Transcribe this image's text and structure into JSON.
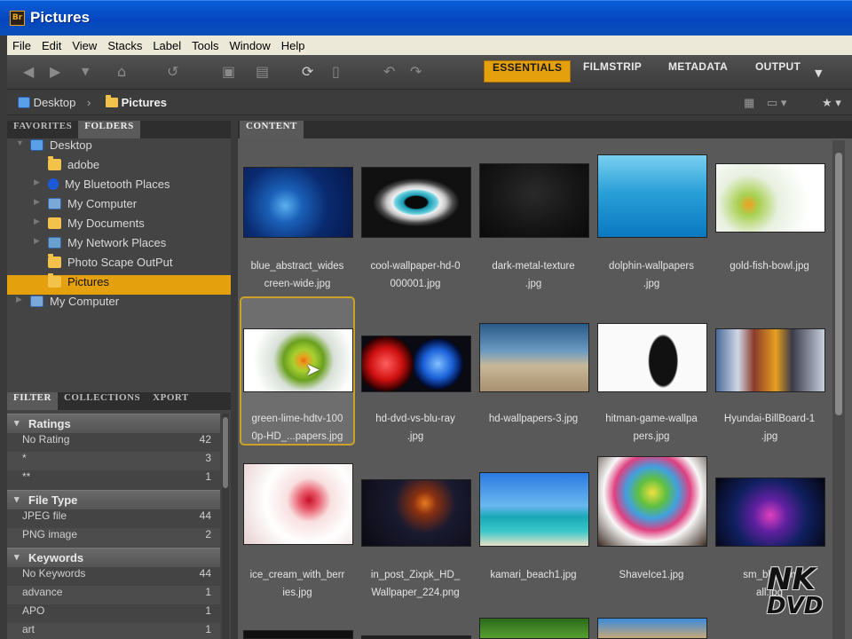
{
  "window": {
    "title": "Pictures",
    "app_icon": "Br"
  },
  "menu": [
    "File",
    "Edit",
    "View",
    "Stacks",
    "Label",
    "Tools",
    "Window",
    "Help"
  ],
  "workspaces": [
    {
      "label": "ESSENTIALS",
      "active": true
    },
    {
      "label": "FILMSTRIP",
      "active": false
    },
    {
      "label": "METADATA",
      "active": false
    },
    {
      "label": "OUTPUT",
      "active": false
    }
  ],
  "path": {
    "root": "Desktop",
    "current": "Pictures"
  },
  "left_tabs": {
    "favorites": "FAVORITES",
    "folders": "FOLDERS"
  },
  "tree": [
    {
      "label": "Desktop"
    },
    {
      "label": "adobe"
    },
    {
      "label": "My Bluetooth Places"
    },
    {
      "label": "My Computer"
    },
    {
      "label": "My Documents"
    },
    {
      "label": "My Network Places"
    },
    {
      "label": "Photo Scape OutPut"
    },
    {
      "label": "Pictures",
      "selected": true
    },
    {
      "label": "My Computer"
    }
  ],
  "filter_tabs": [
    "FILTER",
    "COLLECTIONS",
    "XPORT"
  ],
  "filter": {
    "ratings": {
      "title": "Ratings",
      "rows": [
        {
          "label": "No Rating",
          "count": "42"
        },
        {
          "label": "*",
          "count": "3"
        },
        {
          "label": "**",
          "count": "1"
        }
      ]
    },
    "file_type": {
      "title": "File Type",
      "rows": [
        {
          "label": "JPEG file",
          "count": "44"
        },
        {
          "label": "PNG image",
          "count": "2"
        }
      ]
    },
    "keywords": {
      "title": "Keywords",
      "rows": [
        {
          "label": "No Keywords",
          "count": "44"
        },
        {
          "label": "advance",
          "count": "1"
        },
        {
          "label": "APO",
          "count": "1"
        },
        {
          "label": "art",
          "count": "1"
        }
      ]
    }
  },
  "content_tab": "CONTENT",
  "thumbnails": [
    {
      "line1": "blue_abstract_wides",
      "line2": "creen-wide.jpg"
    },
    {
      "line1": "cool-wallpaper-hd-0",
      "line2": "000001.jpg"
    },
    {
      "line1": "dark-metal-texture",
      "line2": ".jpg"
    },
    {
      "line1": "dolphin-wallpapers",
      "line2": ".jpg"
    },
    {
      "line1": "gold-fish-bowl.jpg",
      "line2": ""
    },
    {
      "line1": "green-lime-hdtv-100",
      "line2": "0p-HD_...papers.jpg",
      "selected": true
    },
    {
      "line1": "hd-dvd-vs-blu-ray",
      "line2": ".jpg"
    },
    {
      "line1": "hd-wallpapers-3.jpg",
      "line2": ""
    },
    {
      "line1": "hitman-game-wallpa",
      "line2": "pers.jpg"
    },
    {
      "line1": "Hyundai-BillBoard-1",
      "line2": ".jpg"
    },
    {
      "line1": "ice_cream_with_berr",
      "line2": "ies.jpg"
    },
    {
      "line1": "in_post_Zixpk_HD_",
      "line2": "Wallpaper_224.png"
    },
    {
      "line1": "kamari_beach1.jpg",
      "line2": ""
    },
    {
      "line1": "ShaveIce1.jpg",
      "line2": ""
    },
    {
      "line1": "sm_blue_m",
      "line2": "all.jpg"
    }
  ],
  "watermark": {
    "top": "NK",
    "bottom": "DVD"
  }
}
